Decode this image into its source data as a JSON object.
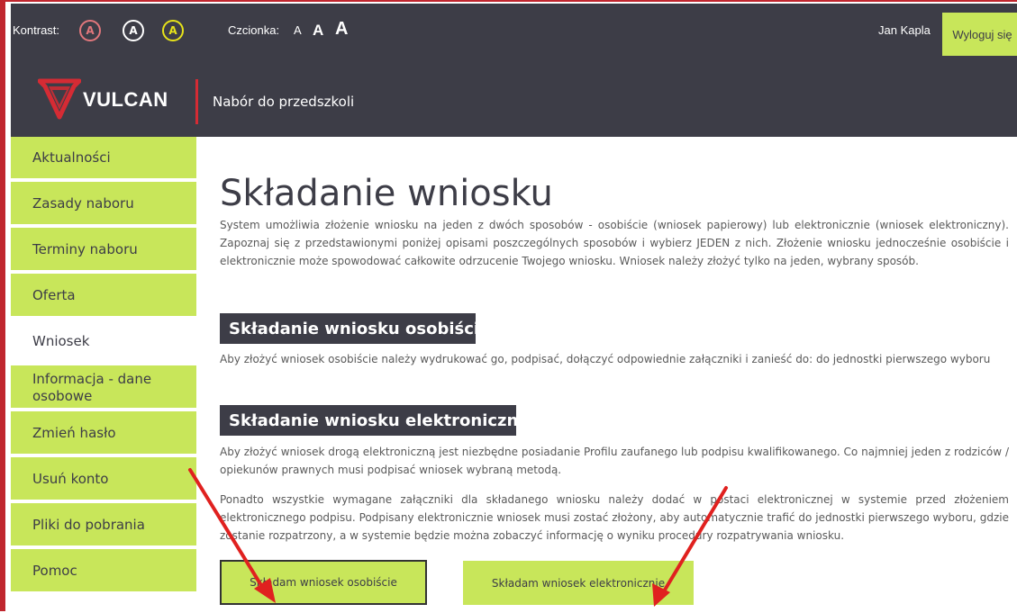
{
  "accessibility": {
    "contrast_label": "Kontrast:",
    "contrast_buttons": [
      "A",
      "A",
      "A"
    ],
    "font_label": "Czcionka:",
    "font_buttons": [
      "A",
      "A",
      "A"
    ]
  },
  "user": {
    "name": "Jan Kapla",
    "logout_label": "Wyloguj się"
  },
  "header": {
    "logo_text": "VULCAN",
    "app_title": "Nabór do przedszkoli"
  },
  "sidebar": {
    "items": [
      {
        "label": "Aktualności"
      },
      {
        "label": "Zasady naboru"
      },
      {
        "label": "Terminy naboru"
      },
      {
        "label": "Oferta"
      },
      {
        "label": "Wniosek"
      },
      {
        "label": "Informacja - dane osobowe"
      },
      {
        "label": "Zmień hasło"
      },
      {
        "label": "Usuń konto"
      },
      {
        "label": "Pliki do pobrania"
      },
      {
        "label": "Pomoc"
      }
    ]
  },
  "main": {
    "title": "Składanie wniosku",
    "intro": "System umożliwia złożenie wniosku na jeden z dwóch sposobów - osobiście (wniosek papierowy) lub elektronicznie (wniosek elektroniczny). Zapoznaj się z przedstawionymi poniżej opisami poszczególnych sposobów i wybierz JEDEN z nich. Złożenie wniosku jednocześnie osobiście i elektronicznie może spowodować całkowite odrzucenie Twojego wniosku. Wniosek należy złożyć tylko na jeden, wybrany sposób.",
    "section_osob_title": "Składanie wniosku osobiście",
    "section_osob_text": "Aby złożyć wniosek osobiście należy wydrukować go, podpisać, dołączyć odpowiednie załączniki i zanieść do: do jednostki pierwszego wyboru",
    "section_elek_title": "Składanie wniosku elektronicznie",
    "section_elek_text": "Aby złożyć wniosek drogą elektroniczną jest niezbędne posiadanie Profilu zaufanego lub podpisu kwalifikowanego. Co najmniej jeden z rodziców / opiekunów prawnych musi podpisać wniosek wybraną metodą.",
    "section_elek_text2": "Ponadto wszystkie wymagane załączniki dla składanego wniosku należy dodać w postaci elektronicznej w systemie przed złożeniem elektronicznego podpisu. Podpisany elektronicznie wniosek musi zostać złożony, aby automatycznie trafić do jednostki pierwszego wyboru, gdzie zostanie rozpatrzony, a w systemie będzie można zobaczyć informację o wyniku procedury rozpatrywania wniosku.",
    "btn_osob": "Składam wniosek osobiście",
    "btn_elek": "Składam wniosek elektronicznie"
  },
  "colors": {
    "dark": "#3d3d47",
    "accent_green": "#c8e65a",
    "brand_red": "#d52b34",
    "arrow_red": "#e0211f"
  },
  "icons": [
    "vulcan-logo-icon",
    "annotation-arrow-icon"
  ]
}
